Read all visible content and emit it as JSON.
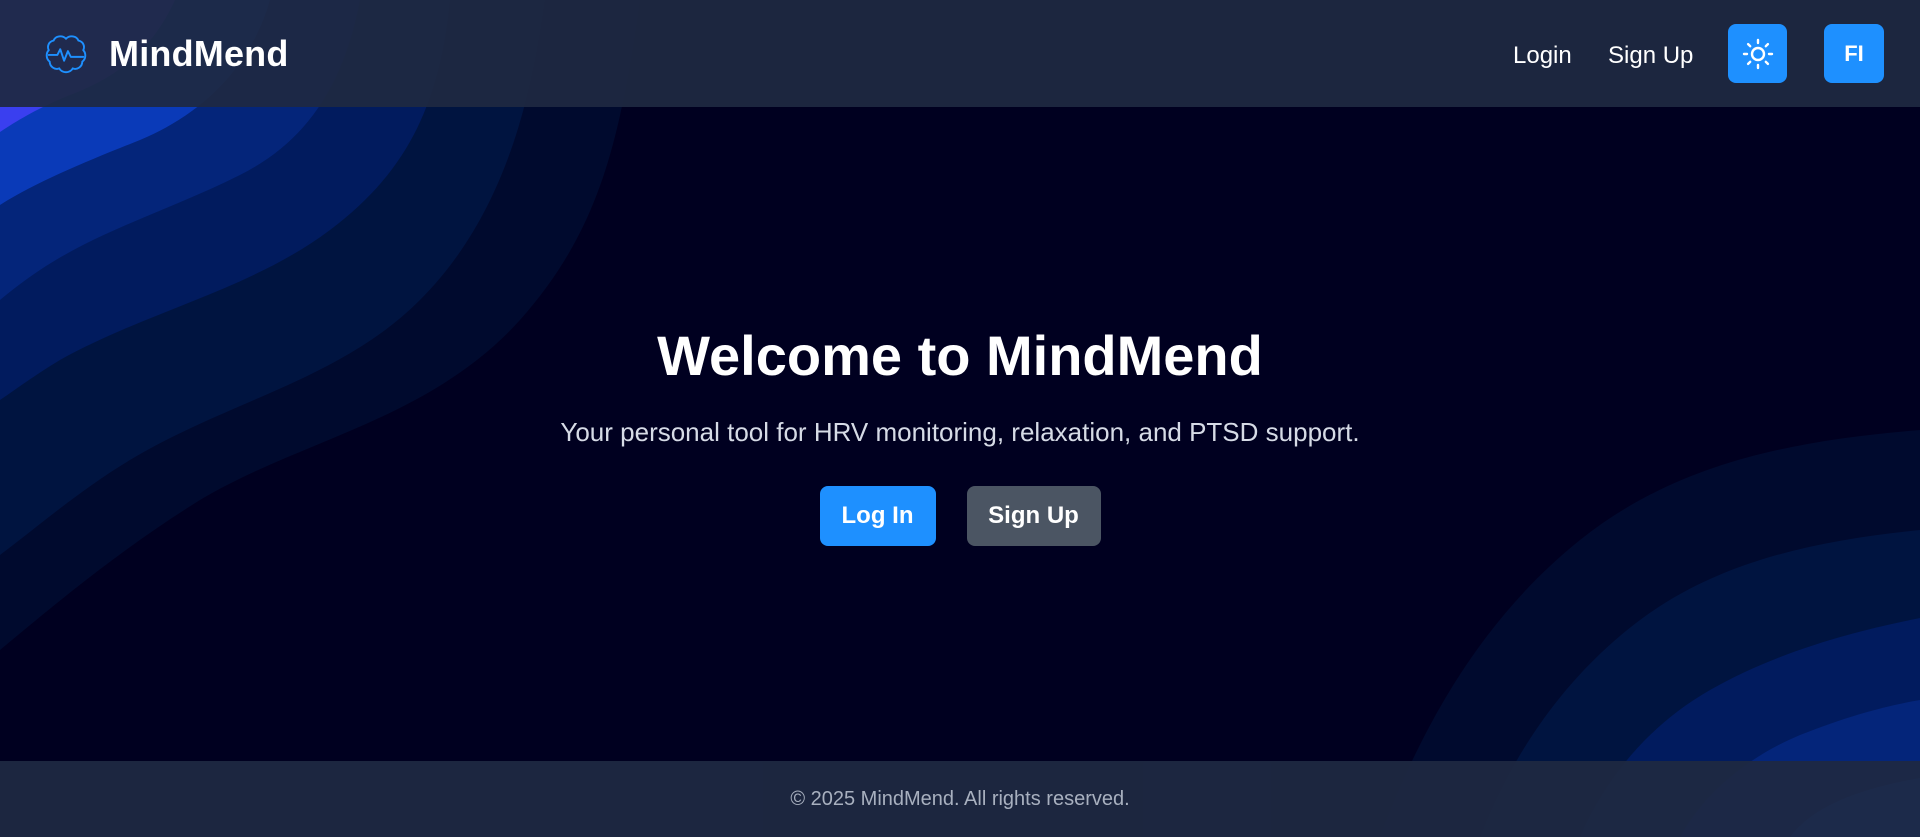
{
  "header": {
    "brand_name": "MindMend",
    "brand_icon": "brain-pulse-icon",
    "nav": {
      "login_label": "Login",
      "signup_label": "Sign Up"
    },
    "theme_toggle_icon": "sun-icon",
    "avatar_initials": "FI"
  },
  "hero": {
    "title": "Welcome to MindMend",
    "subtitle": "Your personal tool for HRV monitoring, relaxation, and PTSD support.",
    "login_button_label": "Log In",
    "signup_button_label": "Sign Up"
  },
  "footer": {
    "copyright": "© 2025 MindMend. All rights reserved."
  },
  "colors": {
    "accent": "#1e90ff",
    "secondary_button": "#4b5563",
    "header_bg": "#1e2942",
    "page_bg": "#000020"
  }
}
